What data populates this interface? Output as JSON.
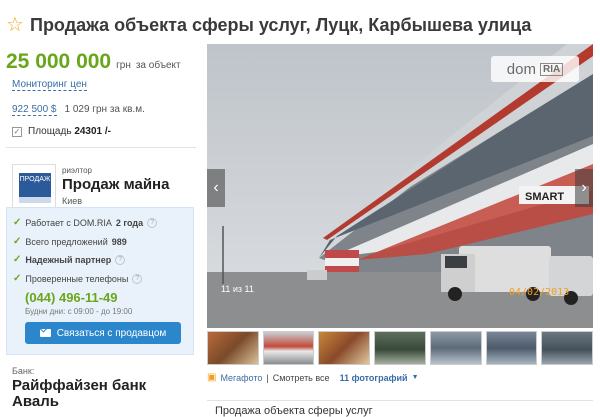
{
  "listing": {
    "title": "Продажа объекта сферы услуг, Луцк, Карбышева  улица",
    "price": "25 000 000",
    "price_unit": "грн",
    "price_per": "за объект",
    "monitoring_link": "Мониторинг цен",
    "usd_price": "922 500 $",
    "price_per_m2": "1 029 грн за кв.м.",
    "area_label": "Площадь",
    "area_value": "24301 /-"
  },
  "agent": {
    "type": "риэлтор",
    "name": "Продаж майна",
    "city": "Киев",
    "logo_text": "ПРОДАЖ"
  },
  "info_panel": {
    "items": [
      {
        "prefix": "Работает с DOM.RIA",
        "value": "2 года"
      },
      {
        "prefix": "Всего предложений",
        "value": "989"
      },
      {
        "prefix": "Надежный партнер",
        "value": ""
      },
      {
        "prefix": "Проверенные телефоны",
        "value": ""
      }
    ],
    "phone": "(044) 496-11-49",
    "hours": "Будни дни: с 09:00 - до 19:00",
    "contact_button": "Связаться с продавцом"
  },
  "bank": {
    "label": "Банк:",
    "name": "Райффайзен банк Аваль"
  },
  "gallery": {
    "counter": "11 из 11",
    "date_stamp": "04/02/2013",
    "watermark_dom": "dom",
    "watermark_ria": "RIA",
    "store_sign": "SMART",
    "thumbnail_count": 7,
    "megafoto": "Мегафото",
    "view_all": "Смотреть все",
    "photos_count": "11 фотографий"
  },
  "description": {
    "heading": "Продажа объекта сферы услуг"
  },
  "icons": {
    "favorite": "star-icon",
    "check": "check-icon",
    "help": "question-icon",
    "mail": "mail-icon",
    "prev": "chevron-left-icon",
    "next": "chevron-right-icon",
    "area": "area-icon",
    "megafoto": "camera-icon"
  },
  "colors": {
    "price_green": "#6aa61a",
    "link_blue": "#3a6ea5",
    "button_blue": "#2b86cc",
    "panel_bg": "#e9f2fb",
    "date_orange": "#f0a020"
  }
}
